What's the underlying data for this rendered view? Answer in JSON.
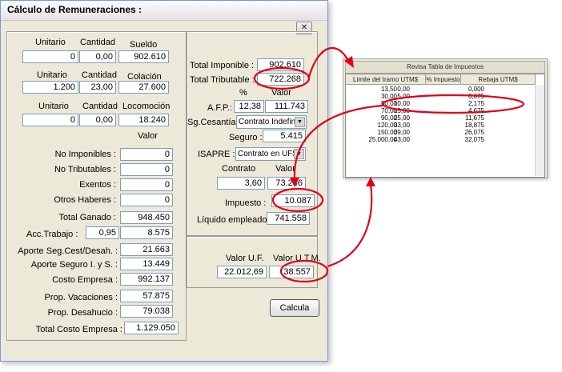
{
  "window": {
    "title": "Cálculo de Remuneraciones :",
    "close_glyph": "✕"
  },
  "left": {
    "headers1": {
      "unitario": "Unitario",
      "cantidad": "Cantidad",
      "value_label": "Sueldo"
    },
    "row1": {
      "unitario": "0",
      "cantidad": "0,00",
      "value": "902.610"
    },
    "headers2": {
      "unitario": "Unitario",
      "cantidad": "Cantidad",
      "value_label": "Colación"
    },
    "row2": {
      "unitario": "1.200",
      "cantidad": "23,00",
      "value": "27.600"
    },
    "headers3": {
      "unitario": "Unitario",
      "cantidad": "Cantidad",
      "value_label": "Locomoción"
    },
    "row3": {
      "unitario": "0",
      "cantidad": "0,00",
      "value": "18.240"
    },
    "valor_header": "Valor",
    "no_imponibles": {
      "label": "No Imponibles :",
      "value": "0"
    },
    "no_tributables": {
      "label": "No Tributables :",
      "value": "0"
    },
    "exentos": {
      "label": "Exentos :",
      "value": "0"
    },
    "otros_haberes": {
      "label": "Otros Haberes :",
      "value": "0"
    },
    "total_ganado": {
      "label": "Total Ganado :",
      "value": "948.450"
    },
    "acc_trabajo": {
      "label": "Acc.Trabajo :",
      "rate": "0,95",
      "value": "8.575"
    },
    "aporte_seg": {
      "label": "Aporte Seg.Cest/Desah. :",
      "value": "21.663"
    },
    "aporte_seguro": {
      "label": "Aporte Seguro I. y S. :",
      "value": "13.449"
    },
    "costo_empresa": {
      "label": "Costo Empresa :",
      "value": "992.137"
    },
    "prop_vacaciones": {
      "label": "Prop. Vacaciones :",
      "value": "57.875"
    },
    "prop_desahucio": {
      "label": "Prop. Desahucio :",
      "value": "79.038"
    },
    "total_costo": {
      "label": "Total Costo Empresa :",
      "value": "1.129.050"
    }
  },
  "right": {
    "total_imponible": {
      "label": "Total Imponible :",
      "value": "902.610"
    },
    "total_tributable": {
      "label": "Total Tributable :",
      "value": "722.268"
    },
    "pct_header": "%",
    "valor_header": "Valor",
    "afp": {
      "label": "A.F.P.:",
      "rate": "12,38",
      "value": "111.743"
    },
    "sg_cesantia": {
      "label": "Sg.Cesantía :",
      "selected": "Contrato Indefinic"
    },
    "seguro": {
      "label": "Seguro :",
      "value": "5.415"
    },
    "isapre": {
      "label": "ISAPRE :",
      "selected": "Contrato en UF$"
    },
    "contrato_header": "Contrato",
    "valor_header2": "Valor",
    "isapre_row": {
      "contrato": "3,60",
      "value": "73.246"
    },
    "impuesto": {
      "label": "Impuesto :",
      "value": "10.087"
    },
    "liquido": {
      "label": "Líquido empleado :",
      "value": "741.558"
    },
    "valor_uf": {
      "label": "Valor U.F.",
      "value": "22.012,69"
    },
    "valor_utm": {
      "label": "Valor U.T.M.",
      "value": "38.557"
    },
    "calcula_button": "Calcula"
  },
  "tax_table": {
    "title": "Revisa Tabla de Impuestos",
    "headers": [
      "Límite del tramo UTM$",
      "% Impuesto",
      "Rebaja UTM$"
    ],
    "rows": [
      [
        "13,50",
        "0,00",
        "0,000"
      ],
      [
        "30,00",
        "5,00",
        "0,675"
      ],
      [
        "50,00",
        "10,00",
        "2,175"
      ],
      [
        "70,00",
        "15,00",
        "4,675"
      ],
      [
        "90,00",
        "25,00",
        "11,675"
      ],
      [
        "120,00",
        "33,00",
        "18,875"
      ],
      [
        "150,00",
        "39,00",
        "26,075"
      ],
      [
        "25.000,00",
        "43,00",
        "32,075"
      ]
    ]
  },
  "colors": {
    "annotation": "#e0001a",
    "window_bg": "#ece9d8",
    "field_border": "#7f9db9"
  }
}
